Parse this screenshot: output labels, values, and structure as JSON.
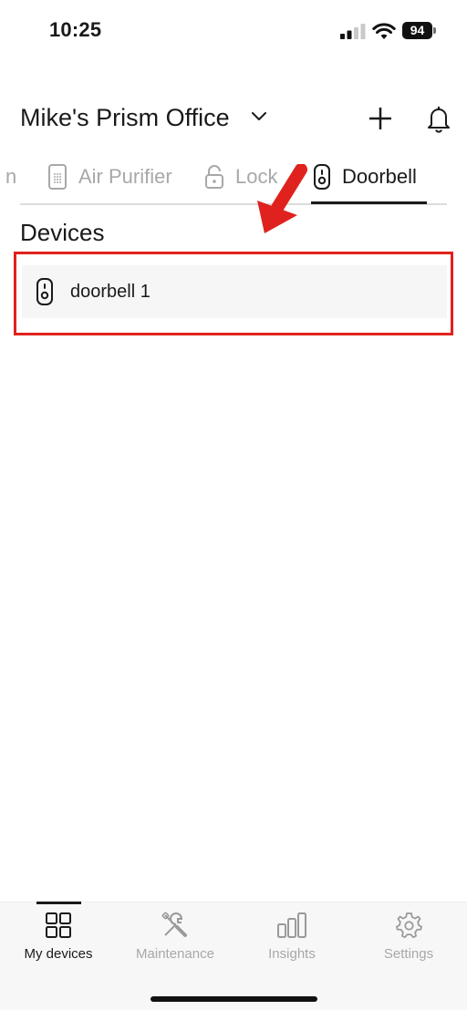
{
  "status_bar": {
    "time": "10:25",
    "battery": "94",
    "icons": [
      "signal-icon",
      "wifi-icon",
      "battery-icon"
    ]
  },
  "header": {
    "site_name": "Mike's Prism Office",
    "icons": [
      "chevron-down-icon",
      "plus-icon",
      "bell-icon"
    ]
  },
  "tabs": {
    "items": [
      {
        "label": "n",
        "icon": "partial-tab",
        "active": false
      },
      {
        "label": "Air Purifier",
        "icon": "air-purifier-icon",
        "active": false
      },
      {
        "label": "Lock",
        "icon": "lock-icon",
        "active": false
      },
      {
        "label": "Doorbell",
        "icon": "doorbell-icon",
        "active": true
      }
    ]
  },
  "devices": {
    "section_title": "Devices",
    "items": [
      {
        "name": "doorbell 1",
        "icon": "doorbell-icon"
      }
    ]
  },
  "annotation": {
    "highlight_color": "#e0221e",
    "arrow_color": "#e0221e"
  },
  "bottom_nav": {
    "items": [
      {
        "label": "My devices",
        "icon": "grid-icon",
        "active": true
      },
      {
        "label": "Maintenance",
        "icon": "tools-icon",
        "active": false
      },
      {
        "label": "Insights",
        "icon": "bar-chart-icon",
        "active": false
      },
      {
        "label": "Settings",
        "icon": "gear-icon",
        "active": false
      }
    ]
  },
  "colors": {
    "text_primary": "#1a1a1a",
    "text_inactive": "#a8a8a8",
    "row_background": "#f6f6f6",
    "nav_background": "#f7f7f7"
  }
}
